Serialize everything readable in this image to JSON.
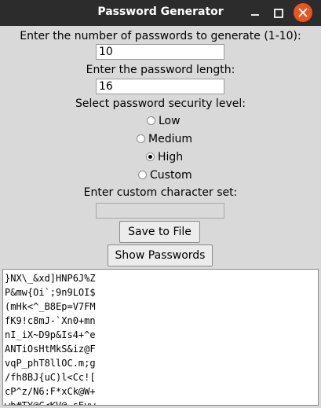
{
  "window": {
    "title": "Password Generator"
  },
  "form": {
    "count_label": "Enter the number of passwords to generate (1-10):",
    "count_value": "10",
    "length_label": "Enter the password length:",
    "length_value": "16",
    "security_label": "Select password security level:",
    "levels": [
      {
        "label": "Low",
        "checked": false
      },
      {
        "label": "Medium",
        "checked": false
      },
      {
        "label": "High",
        "checked": true
      },
      {
        "label": "Custom",
        "checked": false
      }
    ],
    "custom_label": "Enter custom character set:",
    "custom_value": ""
  },
  "buttons": {
    "save": "Save to File",
    "show": "Show Passwords"
  },
  "output": {
    "lines": [
      "}NX\\_&xd]HNP6J%Z",
      "P&mw{Oi`;9n9LOI$",
      "(mHk<^_B8Ep=V7FM",
      "fK9!c8mJ-`Xn0+mn",
      "nI_iX~D9p&Is4+^e",
      "ANTiOsHtMkS&iz@F",
      "vqP_phT8llOC.m;g",
      "/fh8BJ{uC)l<Cc![",
      "cP^z/N6:F*xCk@W+",
      "wb#TY@C<KV@,sEvw"
    ]
  }
}
